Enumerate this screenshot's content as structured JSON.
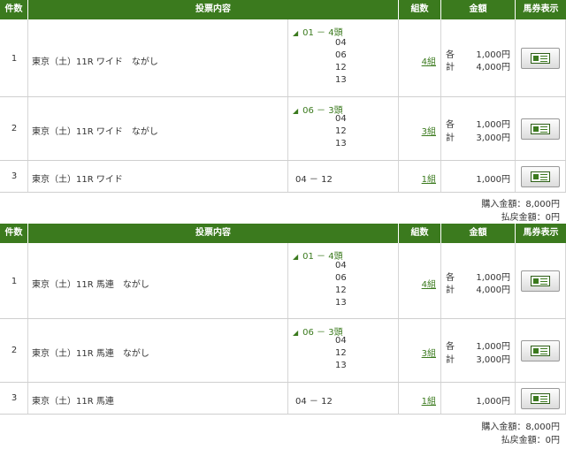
{
  "headers": {
    "num": "件数",
    "content": "投票内容",
    "kumi": "組数",
    "amount": "金額",
    "display": "馬券表示"
  },
  "labels": {
    "each": "各",
    "total": "計",
    "purchase": "購入金額：",
    "refund": "払戻金額："
  },
  "sections": [
    {
      "rows": [
        {
          "num": "1",
          "desc": "東京（土）11R ワイド　ながし",
          "head": "01 － 4頭",
          "combos": [
            "04",
            "06",
            "12",
            "13"
          ],
          "kumi": "4組",
          "each": "1,000円",
          "total": "4,000円"
        },
        {
          "num": "2",
          "desc": "東京（土）11R ワイド　ながし",
          "head": "06 － 3頭",
          "combos": [
            "04",
            "12",
            "13"
          ],
          "kumi": "3組",
          "each": "1,000円",
          "total": "3,000円"
        },
        {
          "num": "3",
          "desc": "東京（土）11R ワイド",
          "flat": "04 － 12",
          "kumi": "1組",
          "amount": "1,000円"
        }
      ],
      "purchase": "8,000円",
      "refund": "0円"
    },
    {
      "rows": [
        {
          "num": "1",
          "desc": "東京（土）11R 馬連　ながし",
          "head": "01 － 4頭",
          "combos": [
            "04",
            "06",
            "12",
            "13"
          ],
          "kumi": "4組",
          "each": "1,000円",
          "total": "4,000円"
        },
        {
          "num": "2",
          "desc": "東京（土）11R 馬連　ながし",
          "head": "06 － 3頭",
          "combos": [
            "04",
            "12",
            "13"
          ],
          "kumi": "3組",
          "each": "1,000円",
          "total": "3,000円"
        },
        {
          "num": "3",
          "desc": "東京（土）11R 馬連",
          "flat": "04 － 12",
          "kumi": "1組",
          "amount": "1,000円"
        }
      ],
      "purchase": "8,000円",
      "refund": "0円"
    }
  ],
  "colors": {
    "header_bg": "#3b7a1e",
    "link": "#3b7a1e"
  }
}
